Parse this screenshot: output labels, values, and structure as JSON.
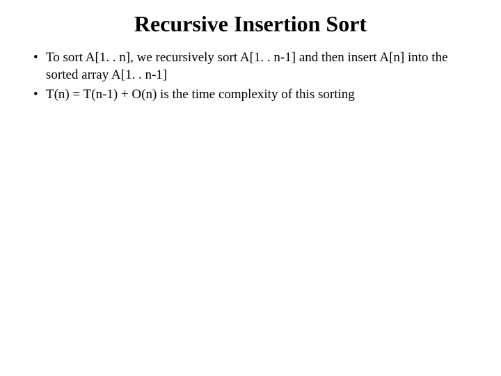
{
  "title": "Recursive Insertion Sort",
  "bullets": {
    "item1": "To sort A[1. . n], we recursively sort A[1. . n-1] and then insert A[n] into the sorted array A[1. . n-1]",
    "item2": "T(n) = T(n-1) + O(n) is the time complexity of this sorting"
  }
}
